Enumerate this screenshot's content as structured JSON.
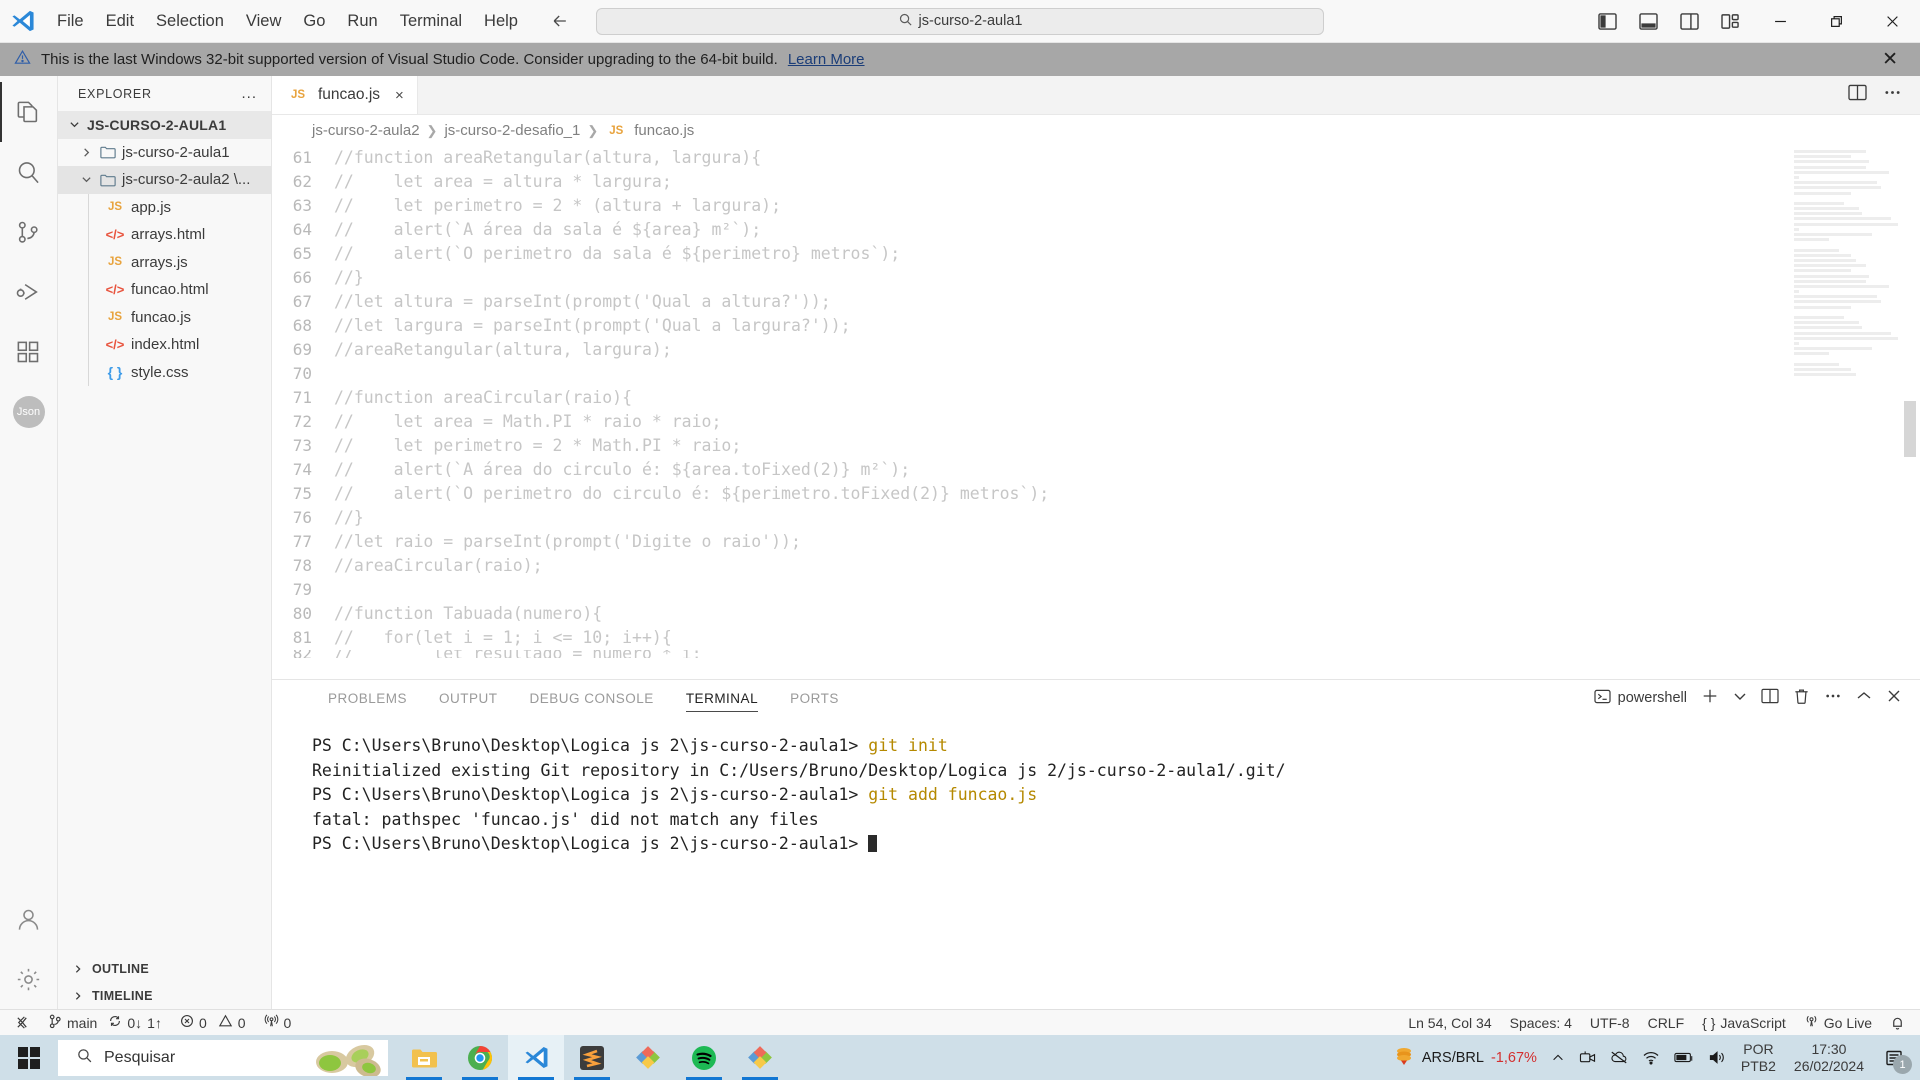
{
  "titlebar": {
    "menu": [
      "File",
      "Edit",
      "Selection",
      "View",
      "Go",
      "Run",
      "Terminal",
      "Help"
    ],
    "search_value": "js-curso-2-aula1",
    "back_icon": "arrow-left-icon",
    "forward_icon": "arrow-right-icon",
    "layout_icons": [
      "toggle-primary-sidebar-icon",
      "toggle-panel-icon",
      "toggle-secondary-sidebar-icon",
      "customize-layout-icon"
    ],
    "window_controls": [
      "minimize",
      "restore",
      "close"
    ]
  },
  "notification": {
    "text": "This is the last Windows 32-bit supported version of Visual Studio Code. Consider upgrading to the 64-bit build.",
    "link": "Learn More",
    "warning_icon": "warning-triangle-icon",
    "close_icon": "close-icon"
  },
  "activitybar": {
    "items": [
      "explorer-icon",
      "search-icon",
      "source-control-icon",
      "run-and-debug-icon",
      "extensions-icon"
    ],
    "badge": "Json",
    "bottom": [
      "account-icon",
      "settings-gear-icon"
    ]
  },
  "sidebar": {
    "title": "EXPLORER",
    "more_actions": "...",
    "root": "JS-CURSO-2-AULA1",
    "folders": [
      {
        "label": "js-curso-2-aula1",
        "expanded": false
      },
      {
        "label": "js-curso-2-aula2 \\...",
        "expanded": true
      }
    ],
    "files": [
      {
        "name": "app.js",
        "icon": "js-file-icon",
        "type": "js"
      },
      {
        "name": "arrays.html",
        "icon": "html-file-icon",
        "type": "html"
      },
      {
        "name": "arrays.js",
        "icon": "js-file-icon",
        "type": "js"
      },
      {
        "name": "funcao.html",
        "icon": "html-file-icon",
        "type": "html"
      },
      {
        "name": "funcao.js",
        "icon": "js-file-icon",
        "type": "js"
      },
      {
        "name": "index.html",
        "icon": "html-file-icon",
        "type": "html"
      },
      {
        "name": "style.css",
        "icon": "css-file-icon",
        "type": "css"
      }
    ],
    "sections": [
      "OUTLINE",
      "TIMELINE"
    ]
  },
  "editor": {
    "tab": {
      "label": "funcao.js",
      "icon": "js-file-icon",
      "close": "×"
    },
    "tab_actions": [
      "split-editor-icon",
      "more-actions-icon"
    ],
    "breadcrumb": [
      "js-curso-2-aula2",
      "js-curso-2-desafio_1",
      "funcao.js"
    ],
    "breadcrumb_file_icon": "js-file-icon",
    "lines": [
      {
        "n": 61,
        "text": "//function areaRetangular(altura, largura){"
      },
      {
        "n": 62,
        "text": "//    let area = altura * largura;"
      },
      {
        "n": 63,
        "text": "//    let perimetro = 2 * (altura + largura);"
      },
      {
        "n": 64,
        "text": "//    alert(`A área da sala é ${area} m²`);"
      },
      {
        "n": 65,
        "text": "//    alert(`O perimetro da sala é ${perimetro} metros`);"
      },
      {
        "n": 66,
        "text": "//}"
      },
      {
        "n": 67,
        "text": "//let altura = parseInt(prompt('Qual a altura?'));"
      },
      {
        "n": 68,
        "text": "//let largura = parseInt(prompt('Qual a largura?'));"
      },
      {
        "n": 69,
        "text": "//areaRetangular(altura, largura);"
      },
      {
        "n": 70,
        "text": ""
      },
      {
        "n": 71,
        "text": "//function areaCircular(raio){"
      },
      {
        "n": 72,
        "text": "//    let area = Math.PI * raio * raio;"
      },
      {
        "n": 73,
        "text": "//    let perimetro = 2 * Math.PI * raio;"
      },
      {
        "n": 74,
        "text": "//    alert(`A área do circulo é: ${area.toFixed(2)} m²`);"
      },
      {
        "n": 75,
        "text": "//    alert(`O perimetro do circulo é: ${perimetro.toFixed(2)} metros`);"
      },
      {
        "n": 76,
        "text": "//}"
      },
      {
        "n": 77,
        "text": "//let raio = parseInt(prompt('Digite o raio'));"
      },
      {
        "n": 78,
        "text": "//areaCircular(raio);"
      },
      {
        "n": 79,
        "text": ""
      },
      {
        "n": 80,
        "text": "//function Tabuada(numero){"
      },
      {
        "n": 81,
        "text": "//   for(let i = 1; i <= 10; i++){"
      },
      {
        "n": 82,
        "text": "//        let resultado = numero * i;"
      }
    ]
  },
  "panel": {
    "tabs": [
      "PROBLEMS",
      "OUTPUT",
      "DEBUG CONSOLE",
      "TERMINAL",
      "PORTS"
    ],
    "active_tab": "TERMINAL",
    "shell": "powershell",
    "shell_icon": "terminal-icon",
    "actions": [
      "new-terminal-icon",
      "chevron-down-icon",
      "split-terminal-icon",
      "kill-terminal-icon",
      "more-actions-icon",
      "maximize-panel-icon",
      "close-panel-icon"
    ],
    "terminal_lines": [
      {
        "prompt": "PS C:\\Users\\Bruno\\Desktop\\Logica js 2\\js-curso-2-aula1> ",
        "cmd": "git init",
        "out": ""
      },
      {
        "prompt": "",
        "cmd": "",
        "out": "Reinitialized existing Git repository in C:/Users/Bruno/Desktop/Logica js 2/js-curso-2-aula1/.git/"
      },
      {
        "prompt": "PS C:\\Users\\Bruno\\Desktop\\Logica js 2\\js-curso-2-aula1> ",
        "cmd": "git add funcao.js",
        "out": ""
      },
      {
        "prompt": "",
        "cmd": "",
        "out": "fatal: pathspec 'funcao.js' did not match any files"
      },
      {
        "prompt": "PS C:\\Users\\Bruno\\Desktop\\Logica js 2\\js-curso-2-aula1> ",
        "cmd": "",
        "out": ""
      }
    ]
  },
  "statusbar": {
    "remote_icon": "remote-window-icon",
    "branch_icon": "source-control-branch-icon",
    "branch": "main",
    "sync_icon": "sync-icon",
    "sync_down": "0↓",
    "sync_up": "1↑",
    "errors_icon": "error-icon",
    "errors": "0",
    "warnings_icon": "warning-icon",
    "warnings": "0",
    "ports_icon": "radio-tower-icon",
    "ports": "0",
    "cursor": "Ln 54, Col 34",
    "spaces": "Spaces: 4",
    "encoding": "UTF-8",
    "eol": "CRLF",
    "language_icon": "braces-icon",
    "language": "JavaScript",
    "golive_icon": "broadcast-icon",
    "golive": "Go Live",
    "bell_icon": "bell-icon"
  },
  "taskbar": {
    "start_icon": "windows-start-icon",
    "search_placeholder": "Pesquisar",
    "search_icon": "search-icon",
    "search_art": "pistachios-image",
    "apps": [
      {
        "name": "file-explorer-icon",
        "active": false,
        "running": true
      },
      {
        "name": "google-chrome-icon",
        "active": false,
        "running": true
      },
      {
        "name": "visual-studio-code-icon",
        "active": true,
        "running": true
      },
      {
        "name": "sublime-text-icon",
        "active": false,
        "running": true
      },
      {
        "name": "app-icon-diamond-1",
        "active": false,
        "running": false
      },
      {
        "name": "spotify-icon",
        "active": false,
        "running": true
      },
      {
        "name": "app-icon-diamond-2",
        "active": false,
        "running": true
      }
    ],
    "tray": {
      "stock_icon": "stock-coin-icon",
      "stock_label": "ARS/BRL",
      "stock_value": "-1,67%",
      "chevron": "show-hidden-icons-chevron",
      "icons": [
        "camera-icon",
        "onedrive-offline-icon",
        "wifi-icon",
        "battery-icon",
        "volume-icon"
      ],
      "lang_top": "POR",
      "lang_bottom": "PTB2",
      "time": "17:30",
      "date": "26/02/2024",
      "notification_icon": "notification-center-icon",
      "notification_count": "1"
    }
  },
  "colors": {
    "accent": "#0078d4",
    "warning_bar": "#a7a7a7",
    "js_icon": "#e8a33d",
    "html_icon": "#e8533d",
    "css_icon": "#3d9be8",
    "taskbar": "#cfdfe8",
    "stock_negative": "#d32f2f"
  }
}
